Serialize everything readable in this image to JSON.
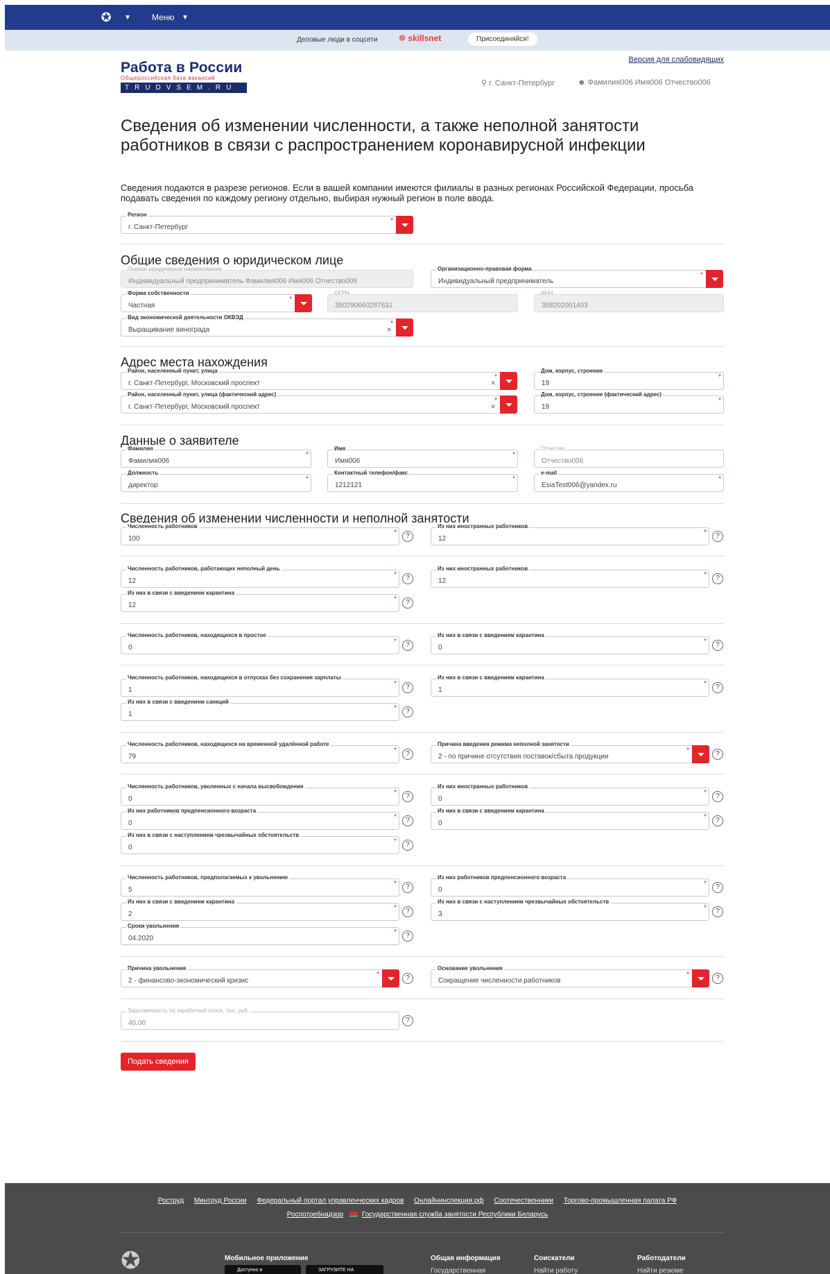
{
  "topbar": {
    "menu_label": "Меню"
  },
  "skills": {
    "text": "Деловые люди в соцсети",
    "logo": "skillsnet",
    "join_label": "Присоединяйся!"
  },
  "brand": {
    "name": "Работа в России",
    "subtitle": "Общероссийская база вакансий",
    "domain": "TRUDVSEM.RU"
  },
  "header": {
    "a11y_link": "Версия для слабовидящих",
    "city": "г. Санкт-Петербург",
    "user": "Фамилия006 Имя006 Отчество006"
  },
  "page": {
    "title": "Сведения об изменении численности, а также неполной занятости работников в связи с распространением коронавирусной инфекции",
    "notice": "Сведения подаются в разрезе регионов. Если в вашей компании имеются филиалы в разных регионах Российской Федерации, просьба подавать сведения по каждому региону отдельно, выбирая нужный регион в поле ввода."
  },
  "region": {
    "label": "Регион",
    "value": "г. Санкт-Петербург"
  },
  "sections": {
    "legal": "Общие сведения о юридическом лице",
    "address": "Адрес места нахождения",
    "applicant": "Данные о заявителе",
    "changes": "Сведения об изменении численности и неполной занятости"
  },
  "legal": {
    "full_name": {
      "label": "Полное юридическое наименование",
      "value": "Индивидуальный предприниматель Фамилия006 Имя006 Отчество006"
    },
    "org_form": {
      "label": "Организационно-правовая форма",
      "value": "Индивидуальный предприниматель"
    },
    "ownership": {
      "label": "Форма собственности",
      "value": "Частная"
    },
    "ogrn": {
      "label": "ОГРН",
      "value": "350290660287631"
    },
    "inn": {
      "label": "ИНН",
      "value": "358202001403"
    },
    "okved": {
      "label": "Вид экономической деятельности ОКВЭД",
      "value": "Выращивание винограда"
    }
  },
  "address": {
    "street": {
      "label": "Район, населенный пункт, улица",
      "value": "г. Санкт-Петербург, Московский проспект"
    },
    "house": {
      "label": "Дом, корпус, строение",
      "value": "19"
    },
    "street_fact": {
      "label": "Район, населенный пункт, улица (фактический адрес)",
      "value": "г. Санкт-Петербург, Московский проспект"
    },
    "house_fact": {
      "label": "Дом, корпус, строение (фактический адрес)",
      "value": "19"
    }
  },
  "applicant": {
    "last_name": {
      "label": "Фамилия",
      "value": "Фамилия006"
    },
    "first_name": {
      "label": "Имя",
      "value": "Имя006"
    },
    "middle_name": {
      "label": "Отчество",
      "value": "Отчество006"
    },
    "position": {
      "label": "Должность",
      "value": "директор"
    },
    "phone": {
      "label": "Контактный телефон/факс",
      "value": "1212121"
    },
    "email": {
      "label": "e-mail",
      "value": "EsiaTest006@yandex.ru"
    }
  },
  "changes": {
    "headcount": {
      "label": "Численность работников",
      "value": "100"
    },
    "headcount_foreign": {
      "label": "Из них иностранных работников",
      "value": "12"
    },
    "part_time": {
      "label": "Численность работников, работающих неполный день",
      "value": "12"
    },
    "part_time_foreign": {
      "label": "Из них иностранных работников",
      "value": "12"
    },
    "part_time_quarantine": {
      "label": "Из них в связи с введением карантина",
      "value": "12"
    },
    "idle": {
      "label": "Численность работников, находящихся в простое",
      "value": "0"
    },
    "idle_quarantine": {
      "label": "Из них в связи с введением карантина",
      "value": "0"
    },
    "unpaid_leave": {
      "label": "Численность работников, находящихся в отпусках без сохранения зарплаты",
      "value": "1"
    },
    "unpaid_leave_quarantine": {
      "label": "Из них в связи с введением карантина",
      "value": "1"
    },
    "unpaid_leave_sanctions": {
      "label": "Из них в связи с введением санкций",
      "value": "1"
    },
    "remote": {
      "label": "Численность работников, находящихся на временной удалённой работе",
      "value": "79"
    },
    "reason_part_time": {
      "label": "Причина введения режима неполной занятости",
      "value": "2 - по причине отсутствия поставок/сбыта продукции"
    },
    "dismissed": {
      "label": "Численность работников, уволенных с начала высвобождения",
      "value": "0"
    },
    "dismissed_foreign": {
      "label": "Из них иностранных работников",
      "value": "0"
    },
    "dismissed_prepension": {
      "label": "Из них работников предпенсионного возраста",
      "value": "0"
    },
    "dismissed_quarantine": {
      "label": "Из них в связи с введением карантина",
      "value": "0"
    },
    "dismissed_emergency": {
      "label": "Из них в связи с наступлением чрезвычайных обстоятельств",
      "value": "0"
    },
    "planned": {
      "label": "Численность работников, предполагаемых к увольнению",
      "value": "5"
    },
    "planned_prepension": {
      "label": "Из них работников предпенсионного возраста",
      "value": "0"
    },
    "planned_quarantine": {
      "label": "Из них в связи с введением карантина",
      "value": "2"
    },
    "planned_emergency": {
      "label": "Из них в связи с наступлением чрезвычайных обстоятельств",
      "value": "3"
    },
    "dismissal_dates": {
      "label": "Сроки увольнения",
      "value": "04.2020"
    },
    "dismissal_reason": {
      "label": "Причина увольнения",
      "value": "2 - финансово-экономический кризис"
    },
    "dismissal_basis": {
      "label": "Основание увольнения",
      "value": "Сокращение численности работников"
    },
    "wage_debt": {
      "label": "Задолженность по заработной плате, тыс. руб.",
      "value": "40.00"
    }
  },
  "form": {
    "submit_label": "Подать сведения"
  },
  "footer": {
    "links": [
      "Роструд",
      "Минтруд России",
      "Федеральный портал управленческих кадров",
      "Онлайнинспекция.рф",
      "Соотечественники",
      "Торгово-промышленная палата РФ"
    ],
    "links2": [
      "Роспотребнадзор",
      "Государственная служба занятости Республики Беларусь"
    ],
    "mobile_title": "Мобильное приложение",
    "store_ios": "Доступно в",
    "store_android": "ЗАГРУЗИТЕ НА",
    "col1_title": "Общая информация",
    "col1_item": "Государственная",
    "col2_title": "Соискатели",
    "col2_item": "Найти работу",
    "col3_title": "Работодатели",
    "col3_item": "Найти резюме"
  }
}
